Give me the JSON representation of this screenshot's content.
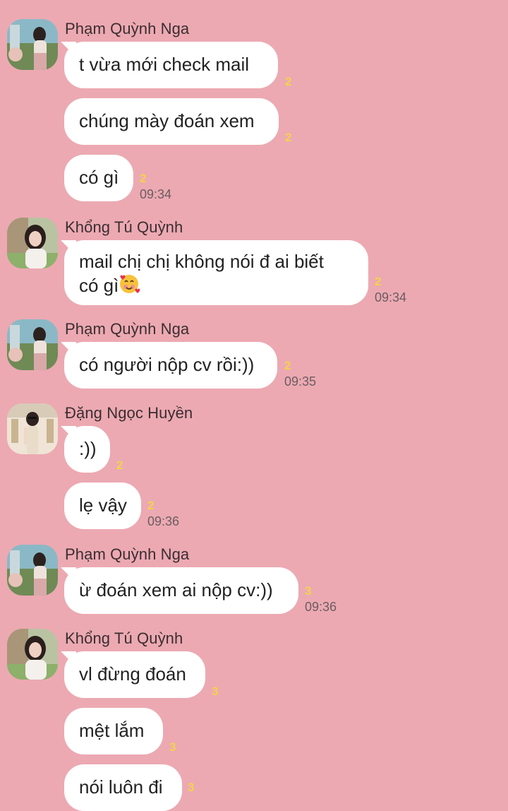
{
  "colors": {
    "background": "#eca9b2",
    "bubble": "#ffffff",
    "read_receipt": "#f3d34a",
    "time": "#6b5d60"
  },
  "groups": [
    {
      "sender": "Phạm Quỳnh Nga",
      "avatar": "avatar-pham-quynh-nga",
      "messages": [
        {
          "text": "t vừa mới check mail",
          "read": "2",
          "time": ""
        },
        {
          "text": "chúng mày đoán xem",
          "read": "2",
          "time": ""
        },
        {
          "text": "có gì",
          "read": "2",
          "time": "09:34"
        }
      ]
    },
    {
      "sender": "Khổng Tú Quỳnh",
      "avatar": "avatar-khong-tu-quynh",
      "messages": [
        {
          "text": "mail chị chị không nói đ ai biết",
          "text_line2": "có gì",
          "emoji": "smiling-face-with-hearts-emoji",
          "read": "2",
          "time": "09:34"
        }
      ]
    },
    {
      "sender": "Phạm Quỳnh Nga",
      "avatar": "avatar-pham-quynh-nga",
      "messages": [
        {
          "text": "có người nộp cv rồi:))",
          "read": "2",
          "time": "09:35"
        }
      ]
    },
    {
      "sender": "Đặng Ngọc Huyền",
      "avatar": "avatar-dang-ngoc-huyen",
      "messages": [
        {
          "text": ":))",
          "read": "2",
          "time": ""
        },
        {
          "text": "lẹ vậy",
          "read": "2",
          "time": "09:36"
        }
      ]
    },
    {
      "sender": "Phạm Quỳnh Nga",
      "avatar": "avatar-pham-quynh-nga",
      "messages": [
        {
          "text": "ừ đoán xem ai nộp cv:))",
          "read": "3",
          "time": "09:36"
        }
      ]
    },
    {
      "sender": "Khổng Tú Quỳnh",
      "avatar": "avatar-khong-tu-quynh",
      "messages": [
        {
          "text": "vl đừng đoán",
          "read": "3",
          "time": ""
        },
        {
          "text": "mệt lắm",
          "read": "3",
          "time": ""
        },
        {
          "text": "nói luôn đi",
          "read": "3",
          "time": ""
        }
      ]
    }
  ]
}
